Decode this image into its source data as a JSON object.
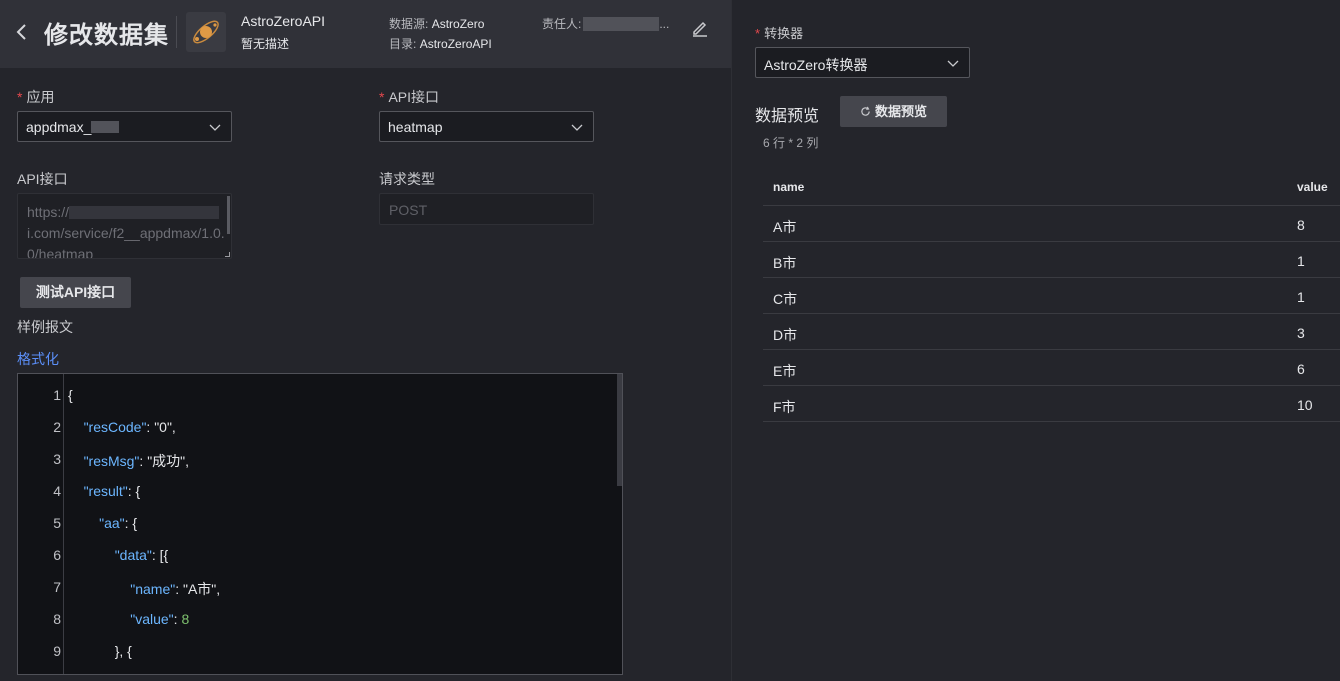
{
  "header": {
    "title": "修改数据集",
    "app_name": "AstroZeroAPI",
    "app_desc": "暂无描述",
    "datasource_label": "数据源:",
    "datasource_value": "AstroZero",
    "catalog_label": "目录:",
    "catalog_value": "AstroZeroAPI",
    "owner_label": "责任人:",
    "owner_ellipsis": "..."
  },
  "form": {
    "app_label": "应用",
    "app_value": "appdmax_",
    "api_label": "API接口",
    "api_value": "heatmap",
    "api_url_label": "API接口",
    "api_url_line1": "https://",
    "api_url_line2": "i.com/service/f2__appdmax/1.0.",
    "api_url_line3": "0/heatmap",
    "req_type_label": "请求类型",
    "req_type_placeholder": "POST",
    "test_button": "测试API接口",
    "sample_label": "样例报文",
    "format_link": "格式化",
    "required_mark": "*"
  },
  "editor": {
    "lines": [
      {
        "n": "1",
        "pre": "",
        "key": "",
        "sep": "{",
        "str": "",
        "num": ""
      },
      {
        "n": "2",
        "pre": "    ",
        "key": "\"resCode\"",
        "sep": ": ",
        "str": "\"0\",",
        "num": ""
      },
      {
        "n": "3",
        "pre": "    ",
        "key": "\"resMsg\"",
        "sep": ": ",
        "str": "\"成功\",",
        "num": ""
      },
      {
        "n": "4",
        "pre": "    ",
        "key": "\"result\"",
        "sep": ": {",
        "str": "",
        "num": ""
      },
      {
        "n": "5",
        "pre": "        ",
        "key": "\"aa\"",
        "sep": ": {",
        "str": "",
        "num": ""
      },
      {
        "n": "6",
        "pre": "            ",
        "key": "\"data\"",
        "sep": ": [{",
        "str": "",
        "num": ""
      },
      {
        "n": "7",
        "pre": "                ",
        "key": "\"name\"",
        "sep": ": ",
        "str": "\"A市\",",
        "num": ""
      },
      {
        "n": "8",
        "pre": "                ",
        "key": "\"value\"",
        "sep": ": ",
        "str": "",
        "num": "8"
      },
      {
        "n": "9",
        "pre": "            ",
        "key": "",
        "sep": "}, {",
        "str": "",
        "num": ""
      }
    ]
  },
  "right": {
    "converter_label": "转换器",
    "converter_value": "AstroZero转换器",
    "preview_title": "数据预览",
    "preview_button": "数据预览",
    "row_count": "6 行 * 2 列",
    "columns": [
      "name",
      "value"
    ],
    "rows": [
      [
        "A市",
        "8"
      ],
      [
        "B市",
        "1"
      ],
      [
        "C市",
        "1"
      ],
      [
        "D市",
        "3"
      ],
      [
        "E市",
        "6"
      ],
      [
        "F市",
        "10"
      ]
    ]
  },
  "icons": [
    "chevron-left-icon",
    "app-logo-icon",
    "edit-pencil-icon",
    "chevron-down-icon",
    "refresh-icon"
  ],
  "colors": {
    "accent": "#5b8ff9",
    "required": "#e5484d",
    "json_key": "#6cb6ff",
    "json_number": "#7ec16e"
  }
}
